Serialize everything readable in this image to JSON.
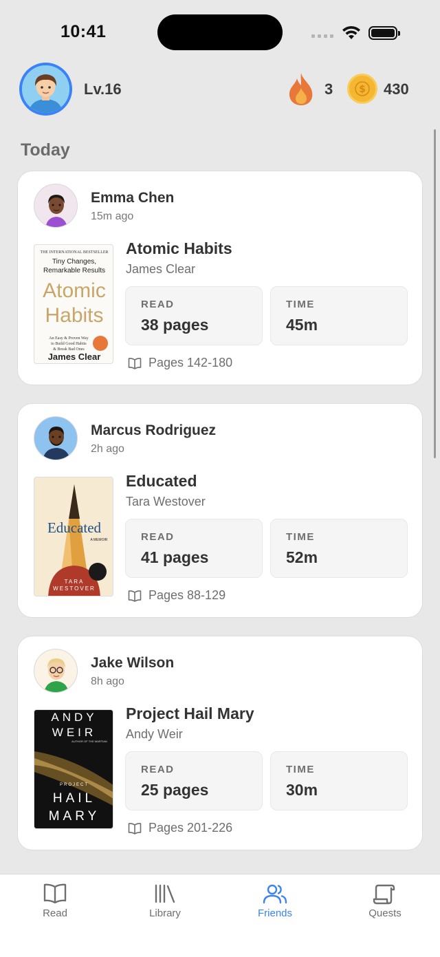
{
  "status_bar": {
    "time": "10:41"
  },
  "header": {
    "level": "Lv.16",
    "streak": "3",
    "coins": "430"
  },
  "section_title": "Today",
  "feed": [
    {
      "user": "Emma Chen",
      "time_ago": "15m ago",
      "book_title": "Atomic Habits",
      "author": "James Clear",
      "read_label": "READ",
      "read_value": "38 pages",
      "time_label": "TIME",
      "time_value": "45m",
      "pages": "Pages 142-180",
      "cover": {
        "top_line": "THE INTERNATIONAL BESTSELLER",
        "subtitle_1": "Tiny Changes,",
        "subtitle_2": "Remarkable Results",
        "title_1": "Atomic",
        "title_2": "Habits",
        "tag_1": "An Easy & Proven Way",
        "tag_2": "to Build Good Habits",
        "tag_3": "& Break Bad Ones",
        "author": "James Clear"
      }
    },
    {
      "user": "Marcus Rodriguez",
      "time_ago": "2h ago",
      "book_title": "Educated",
      "author": "Tara Westover",
      "read_label": "READ",
      "read_value": "41 pages",
      "time_label": "TIME",
      "time_value": "52m",
      "pages": "Pages 88-129",
      "cover": {
        "title": "Educated",
        "memoir": "A MEMOIR",
        "author_1": "TARA",
        "author_2": "WESTOVER"
      }
    },
    {
      "user": "Jake Wilson",
      "time_ago": "8h ago",
      "book_title": "Project Hail Mary",
      "author": "Andy Weir",
      "read_label": "READ",
      "read_value": "25 pages",
      "time_label": "TIME",
      "time_value": "30m",
      "pages": "Pages 201-226",
      "cover": {
        "author_1": "ANDY",
        "author_2": "WEIR",
        "author_note": "AUTHOR OF THE MARTIAN",
        "project": "PROJECT",
        "title_1": "HAIL",
        "title_2": "MARY"
      }
    }
  ],
  "tabs": [
    {
      "label": "Read",
      "icon": "book-open-icon",
      "active": false
    },
    {
      "label": "Library",
      "icon": "library-icon",
      "active": false
    },
    {
      "label": "Friends",
      "icon": "friends-icon",
      "active": true
    },
    {
      "label": "Quests",
      "icon": "scroll-icon",
      "active": false
    }
  ],
  "colors": {
    "accent": "#3b82f6",
    "streak": "#e8773a",
    "coin": "#f5b731"
  }
}
